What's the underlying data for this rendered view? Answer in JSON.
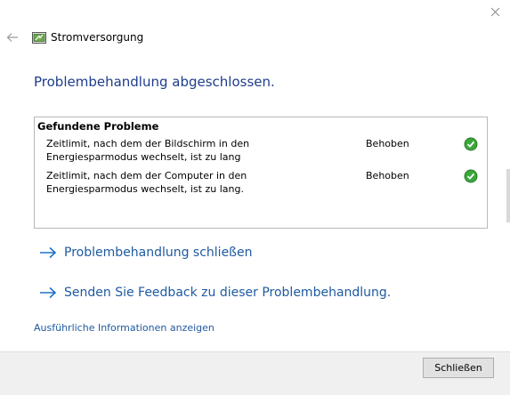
{
  "titlebar": {
    "close_icon": "close-icon",
    "back_icon": "back-arrow-icon"
  },
  "app": {
    "title": "Stromversorgung",
    "icon": "power-battery-icon"
  },
  "heading": "Problembehandlung abgeschlossen.",
  "problems": {
    "header": "Gefundene Probleme",
    "items": [
      {
        "text": "Zeitlimit, nach dem der Bildschirm in den Energiesparmodus wechselt, ist zu lang",
        "status": "Behoben",
        "icon": "check-circle-icon"
      },
      {
        "text": "Zeitlimit, nach dem der Computer in den Energiesparmodus wechselt, ist zu lang.",
        "status": "Behoben",
        "icon": "check-circle-icon"
      }
    ]
  },
  "links": [
    {
      "label": "Problembehandlung schließen",
      "icon": "arrow-right-icon"
    },
    {
      "label": "Senden Sie Feedback zu dieser Problembehandlung.",
      "icon": "arrow-right-icon"
    }
  ],
  "details_link": "Ausführliche Informationen anzeigen",
  "footer": {
    "close_label": "Schließen"
  },
  "colors": {
    "heading": "#1e3c8c",
    "link": "#1e5aa0",
    "success": "#2e9e2e",
    "footer_bg": "#f0f0f0"
  }
}
